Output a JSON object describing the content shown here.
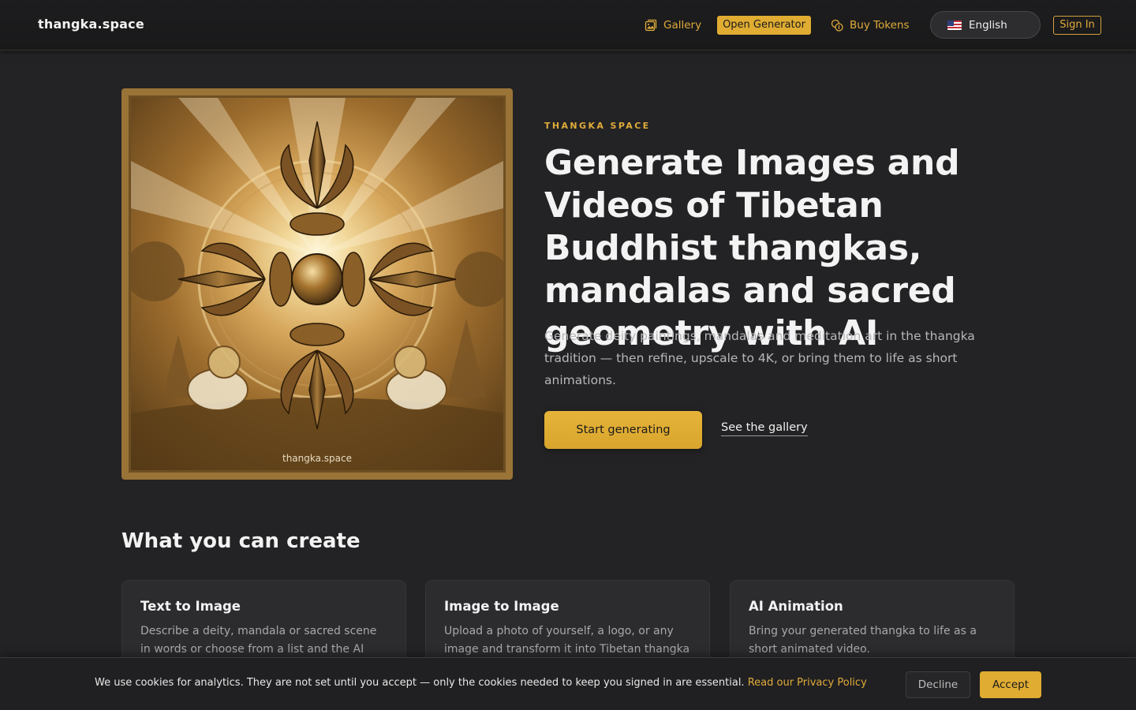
{
  "header": {
    "brand": "thangka.space",
    "nav": {
      "gallery": "Gallery",
      "open_generator": "Open Generator",
      "buy_tokens": "Buy Tokens",
      "language": "English",
      "sign_in": "Sign In"
    },
    "icons": {
      "gallery": "image-gallery-icon",
      "tokens": "coins-icon",
      "language": "us-flag-icon"
    }
  },
  "hero": {
    "image_watermark": "thangka.space",
    "eyebrow": "THANGKA SPACE",
    "headline": "Generate Images and Videos of Tibetan Buddhist thangkas, mandalas and sacred geometry with AI",
    "subtitle": "Generate deity paintings, mandalas and meditation art in the thangka tradition — then refine, upscale to 4K, or bring them to life as short animations.",
    "cta_primary": "Start generating",
    "cta_secondary": "See the gallery"
  },
  "features": {
    "title": "What you can create",
    "cards": [
      {
        "title": "Text to Image",
        "body": "Describe a deity, mandala or sacred scene in words or choose from a list and the AI"
      },
      {
        "title": "Image to Image",
        "body": "Upload a photo of yourself, a logo, or any image and transform it into Tibetan thangka"
      },
      {
        "title": "AI Animation",
        "body": "Bring your generated thangka to life as a short animated video."
      }
    ]
  },
  "cookie_banner": {
    "text": "We use cookies for analytics. They are not set until you accept — only the cookies needed to keep you signed in are essential. ",
    "link": "Read our Privacy Policy",
    "decline": "Decline",
    "accept": "Accept"
  },
  "colors": {
    "accent": "#e0ac32",
    "background": "#232325",
    "card": "#2c2c2f"
  }
}
